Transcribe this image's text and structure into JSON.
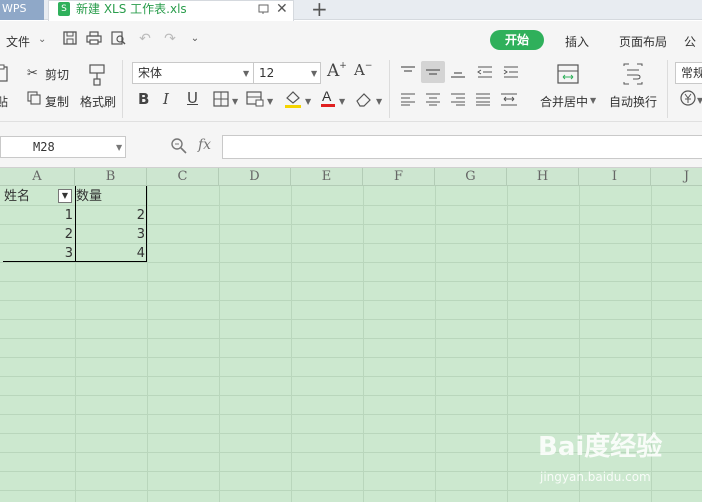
{
  "tabbar": {
    "app_tab": "WPS",
    "doc_icon": "S",
    "doc_title": "新建 XLS 工作表.xls"
  },
  "menu": {
    "file": "文件",
    "tabs": [
      "开始",
      "插入",
      "页面布局",
      "公"
    ]
  },
  "ribbon": {
    "cut": "剪切",
    "copy": "复制",
    "paste_partial": "贴",
    "format_painter": "格式刷",
    "font_name": "宋体",
    "font_size": "12",
    "merge_center": "合并居中",
    "wrap_text": "自动换行",
    "number_format": "常规"
  },
  "formula_bar": {
    "name_box": "M28",
    "fx": "fx",
    "formula": ""
  },
  "sheet": {
    "columns": [
      "A",
      "B",
      "C",
      "D",
      "E",
      "F",
      "G",
      "H",
      "I",
      "J"
    ],
    "header": {
      "a": "姓名",
      "b": "数量"
    },
    "rows": [
      {
        "a": "1",
        "b": "2"
      },
      {
        "a": "2",
        "b": "3"
      },
      {
        "a": "3",
        "b": "4"
      }
    ]
  },
  "watermark": {
    "logo": "Bai度经验",
    "url": "jingyan.baidu.com"
  },
  "colors": {
    "accent": "#2fb05b",
    "sheet_bg": "#cce8cf",
    "grid": "#b9d6bc"
  }
}
